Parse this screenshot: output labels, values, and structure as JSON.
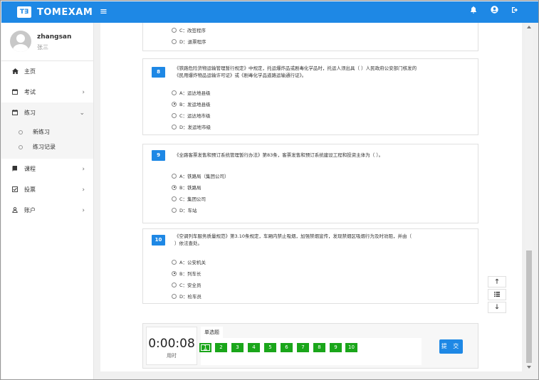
{
  "app": {
    "logo_text": "T∃",
    "name": "TOMEXAM"
  },
  "header": {
    "menu_icon": "hamburger-icon",
    "icons": [
      "bell-icon",
      "user-icon",
      "logout-icon"
    ]
  },
  "user": {
    "username": "zhangsan",
    "realname": "张三"
  },
  "sidebar": {
    "items": [
      {
        "label": "主页",
        "icon": "home-icon"
      },
      {
        "label": "考试",
        "icon": "calendar-icon"
      },
      {
        "label": "练习",
        "icon": "calendar-icon"
      },
      {
        "label": "课程",
        "icon": "book-icon"
      },
      {
        "label": "投票",
        "icon": "checkbox-icon"
      },
      {
        "label": "账户",
        "icon": "person-icon"
      }
    ],
    "sub_items": [
      {
        "label": "新练习"
      },
      {
        "label": "练习记录"
      }
    ]
  },
  "prev_question": {
    "options": [
      {
        "label": "C：改签程序"
      },
      {
        "label": "D：退票程序"
      }
    ]
  },
  "questions": [
    {
      "number": "8",
      "text_line1": "《铁路危险货物运输管理暂行规定》中规定，托运爆炸品或剧毒化学品时，托运人须出具（ ）人民政府公安部门核发的",
      "text_line2": "《民用爆炸物品运输许可证》或《剧毒化学品道路运输通行证》。",
      "options": [
        {
          "label": "A：运达地县级",
          "selected": false
        },
        {
          "label": "B：发运地县级",
          "selected": true
        },
        {
          "label": "C：运达地市级",
          "selected": false
        },
        {
          "label": "D：发运地市级",
          "selected": false
        }
      ]
    },
    {
      "number": "9",
      "text_line1": "《全路客票发售和预订系统管理暂行办法》第83条，客票发售和预订系统建设工程和投资主体为（ ）。",
      "text_line2": "",
      "options": [
        {
          "label": "A：铁路局（集团公司）",
          "selected": false
        },
        {
          "label": "B：铁路局",
          "selected": true
        },
        {
          "label": "C：集团公司",
          "selected": false
        },
        {
          "label": "D：车站",
          "selected": false
        }
      ]
    },
    {
      "number": "10",
      "text_line1": "《空调列车服务质量规范》第3.10条规定，车厢内禁止吸烟，加强禁烟宣传，发现禁烟区吸烟行为及时劝阻，并由（",
      "text_line2": "）依法查处。",
      "options": [
        {
          "label": "A：公安机关",
          "selected": false
        },
        {
          "label": "B：列车长",
          "selected": true
        },
        {
          "label": "C：安全员",
          "selected": false
        },
        {
          "label": "D：检车员",
          "selected": false
        }
      ]
    }
  ],
  "side_buttons": [
    "arrow-up-icon",
    "list-icon",
    "arrow-down-icon"
  ],
  "answer_sheet": {
    "timer": "0:00:08",
    "timer_label": "用时",
    "tab_label": "单选题",
    "numbers": [
      "1",
      "2",
      "3",
      "4",
      "5",
      "6",
      "7",
      "8",
      "9",
      "10"
    ],
    "current": "1",
    "submit_label": "提 交"
  },
  "colors": {
    "primary": "#1e88e5",
    "answered": "#1aa61a"
  }
}
